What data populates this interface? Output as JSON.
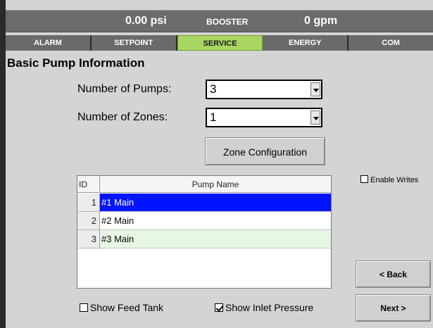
{
  "header": {
    "pressure": "0.00 psi",
    "mode": "BOOSTER",
    "flow": "0 gpm"
  },
  "tabs": [
    {
      "label": "ALARM",
      "active": false
    },
    {
      "label": "SETPOINT",
      "active": false
    },
    {
      "label": "SERVICE",
      "active": true
    },
    {
      "label": "ENERGY",
      "active": false
    },
    {
      "label": "COM",
      "active": false
    }
  ],
  "page": {
    "title": "Basic Pump Information"
  },
  "form": {
    "pumps_label": "Number of Pumps:",
    "pumps_value": "3",
    "zones_label": "Number of Zones:",
    "zones_value": "1",
    "zone_config_label": "Zone Configuration"
  },
  "table": {
    "columns": [
      "ID",
      "Pump Name"
    ],
    "rows": [
      {
        "id": "1",
        "name": "#1 Main",
        "selected": true
      },
      {
        "id": "2",
        "name": "#2 Main",
        "selected": false
      },
      {
        "id": "3",
        "name": "#3 Main",
        "selected": false
      }
    ]
  },
  "options": {
    "enable_writes_label": "Enable Writes",
    "enable_writes_checked": false,
    "show_feed_tank_label": "Show Feed Tank",
    "show_feed_tank_checked": false,
    "show_inlet_pressure_label": "Show Inlet Pressure",
    "show_inlet_pressure_checked": true
  },
  "nav": {
    "back_label": "< Back",
    "next_label": "Next >"
  },
  "colors": {
    "active_tab": "#a9d563",
    "selected_row": "#0014ff",
    "alt_row": "#e8f6e4",
    "header_bg": "#6b6b6b"
  }
}
